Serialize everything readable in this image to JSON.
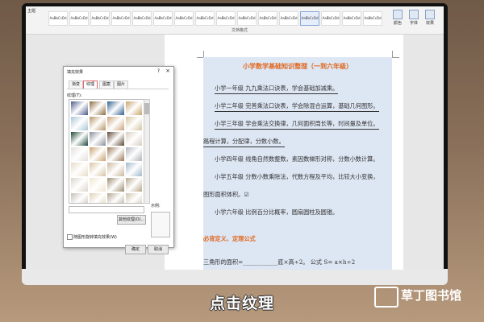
{
  "ribbon": {
    "left_label": "主题",
    "styles": [
      "AaBbCcDd",
      "AaBbCcDd",
      "AaBbCcDd",
      "AaBbCcDd",
      "AaBbCcDd",
      "AaBbCcDd",
      "AaBbCcDd",
      "AaBbCcDd",
      "AaBbCcDd",
      "AaBbCcDd",
      "AaBbCcDd",
      "AaBbCcDd",
      "AaBbCcDd",
      "AaBbCcDd",
      "AaBbCcDd",
      "AaBbCcDd"
    ],
    "group_label": "文档格式",
    "right_buttons": [
      "颜色",
      "字体",
      "效果"
    ]
  },
  "document": {
    "title": "小学数学基础知识整理（一到六年级）",
    "lines": [
      "小学一年级  九九乘法口诀表，学会基础加减乘。",
      "小学二年级  完善乘法口诀表，学会除混合运算，基础几何图形。",
      "小学三年级  学会乘法交换律，几何面积周长等，时间量及单位。",
      "路程计算，分配律，分数小数。",
      "小学四年级  线角自然数整数，素因数梯形对称，分数小数计算。",
      "小学五年级  分数小数乘除法，代数方程及平均，比较大小变换，",
      "图形面积体积。☑",
      "小学六年级  比例百分比概率，圆扇圆柱及圆锥。"
    ],
    "heading": "必背定义、定理公式",
    "formula": "三角形的面积=____________底×高÷2。 公式 S= a×h÷2"
  },
  "dialog": {
    "title": "填充效果",
    "help": "?",
    "close": "×",
    "tabs": [
      "渐变",
      "纹理",
      "图案",
      "图片"
    ],
    "active_tab": "纹理",
    "texture_label": "纹理(T):",
    "other_texture_button": "其他纹理(O)...",
    "sample_label": "示例:",
    "rotate_checkbox_label": "随图形旋转填充效果(W)",
    "ok_button": "确定",
    "cancel_button": "取消",
    "texture_colors": [
      "#4d5a8a",
      "#8c6b3e",
      "#2f5f8f",
      "#c7a36a",
      "#a9c6d8",
      "#b89466",
      "#caa37c",
      "#d2c49e",
      "#1f4a3a",
      "#8a8f99",
      "#5f4a35",
      "#d8cfbf",
      "#e4e0dc",
      "#c8a06c",
      "#9a7a5a",
      "#b0b4b9",
      "#e8dcc8",
      "#d7c3a2",
      "#cbb79f",
      "#a2b8c8",
      "#dcd7cc",
      "#f0e6d0",
      "#9a8c70",
      "#b8a68a",
      "#c6c1b4",
      "#ddd0b5",
      "#b0a591",
      "#cfc5b0"
    ]
  },
  "caption": "点击纹理",
  "watermark": "草丁图书馆"
}
